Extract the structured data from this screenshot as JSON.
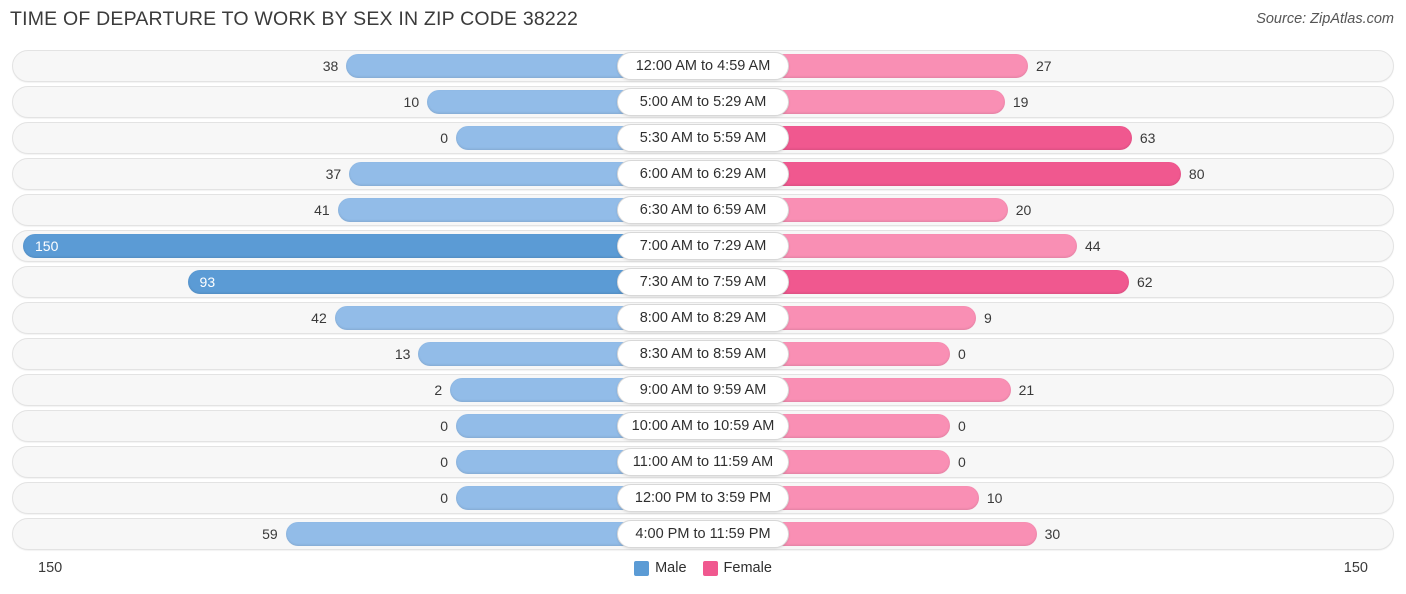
{
  "header": {
    "title": "TIME OF DEPARTURE TO WORK BY SEX IN ZIP CODE 38222",
    "source": "Source: ZipAtlas.com"
  },
  "axis": {
    "left_max": "150",
    "right_max": "150"
  },
  "legend": {
    "items": [
      {
        "label": "Male",
        "color": "#5b9bd5"
      },
      {
        "label": "Female",
        "color": "#f0588f"
      }
    ]
  },
  "colors": {
    "male_light": "#92bce8",
    "male_strong": "#5b9bd5",
    "female_light": "#f98fb4",
    "female_strong": "#f0588f",
    "track_fill": "#f7f7f7",
    "track_border": "#e3e3e3"
  },
  "chart_data": {
    "type": "bar",
    "title": "TIME OF DEPARTURE TO WORK BY SEX IN ZIP CODE 38222",
    "subtitle": "",
    "xlabel": "",
    "ylabel": "",
    "orientation": "horizontal-diverging",
    "xlim": [
      150,
      150
    ],
    "axis_max": 150,
    "grid": false,
    "legend_position": "bottom-center",
    "categories": [
      "12:00 AM to 4:59 AM",
      "5:00 AM to 5:29 AM",
      "5:30 AM to 5:59 AM",
      "6:00 AM to 6:29 AM",
      "6:30 AM to 6:59 AM",
      "7:00 AM to 7:29 AM",
      "7:30 AM to 7:59 AM",
      "8:00 AM to 8:29 AM",
      "8:30 AM to 8:59 AM",
      "9:00 AM to 9:59 AM",
      "10:00 AM to 10:59 AM",
      "11:00 AM to 11:59 AM",
      "12:00 PM to 3:59 PM",
      "4:00 PM to 11:59 PM"
    ],
    "series": [
      {
        "name": "Male",
        "values": [
          38,
          10,
          0,
          37,
          41,
          150,
          93,
          42,
          13,
          2,
          0,
          0,
          0,
          59
        ]
      },
      {
        "name": "Female",
        "values": [
          27,
          19,
          63,
          80,
          20,
          44,
          62,
          9,
          0,
          21,
          0,
          0,
          10,
          30
        ]
      }
    ]
  }
}
